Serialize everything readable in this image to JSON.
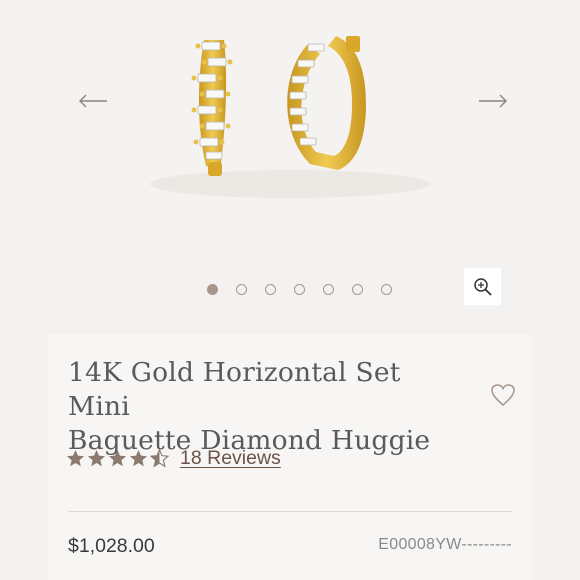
{
  "colors": {
    "accent": "#a8968a",
    "gold": "#e2b93b",
    "text": "#3a3a3a",
    "link": "#6a5448"
  },
  "gallery": {
    "image": "baguette-diamond-huggie-earrings",
    "prev_icon": "arrow-left-icon",
    "next_icon": "arrow-right-icon",
    "slide_count": 7,
    "active_slide": 1,
    "zoom_icon": "zoom-in-icon"
  },
  "product": {
    "title_line1": "14K Gold Horizontal Set Mini",
    "title_line2": "Baguette Diamond Huggie",
    "wishlist_icon": "heart-icon",
    "rating": 4.5,
    "rating_max": 5,
    "reviews_label": "18 Reviews",
    "price": "$1,028.00",
    "sku": "E00008YW---------"
  }
}
